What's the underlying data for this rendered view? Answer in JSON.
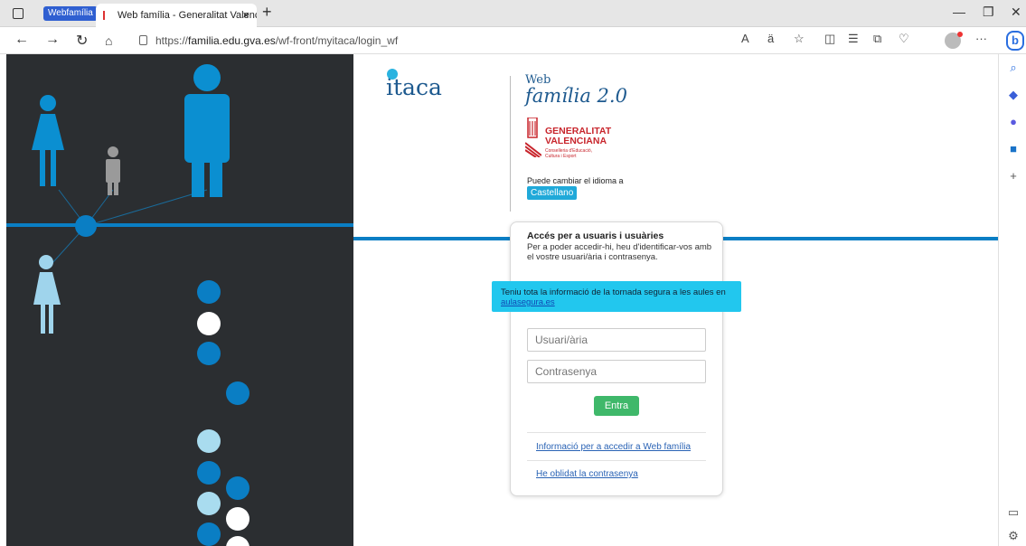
{
  "browser": {
    "tab_group_label": "Webfamília",
    "tab_title": "Web família - Generalitat Valenci",
    "tab_close": "×",
    "new_tab": "+",
    "url_prefix": "https://",
    "url_host": "familia.edu.gva.es",
    "url_path": "/wf-front/myitaca/login_wf",
    "more": "···"
  },
  "brand": {
    "logo_text": "itaca",
    "web_label": "Web",
    "product_name": "família 2.0",
    "gov_line1": "GENERALITAT",
    "gov_line2": "VALENCIANA",
    "gov_dept_1": "Conselleria d'Educació,",
    "gov_dept_2": "Cultura i Esport"
  },
  "language": {
    "prompt": "Puede cambiar el idioma a",
    "button": "Castellano"
  },
  "login": {
    "title": "Accés per a usuaris i usuàries",
    "description": "Per a poder accedir-hi, heu d'identificar-vos amb el vostre usuari/ària i contrasenya.",
    "username_placeholder": "Usuari/ària",
    "password_placeholder": "Contrasenya",
    "submit": "Entra",
    "info_link": "Informació per a accedir a Web família",
    "forgot_link": "He oblidat la contrasenya"
  },
  "notice": {
    "text": "Teniu tota la informació de la tornada segura a les aules en ",
    "link": "aulasegura.es"
  },
  "colors": {
    "accent_blue": "#0a7ec4",
    "light_blue": "#2ab3e0",
    "gov_red": "#c8252c",
    "green": "#3fb86a",
    "dark_bg": "#2b2e31"
  }
}
